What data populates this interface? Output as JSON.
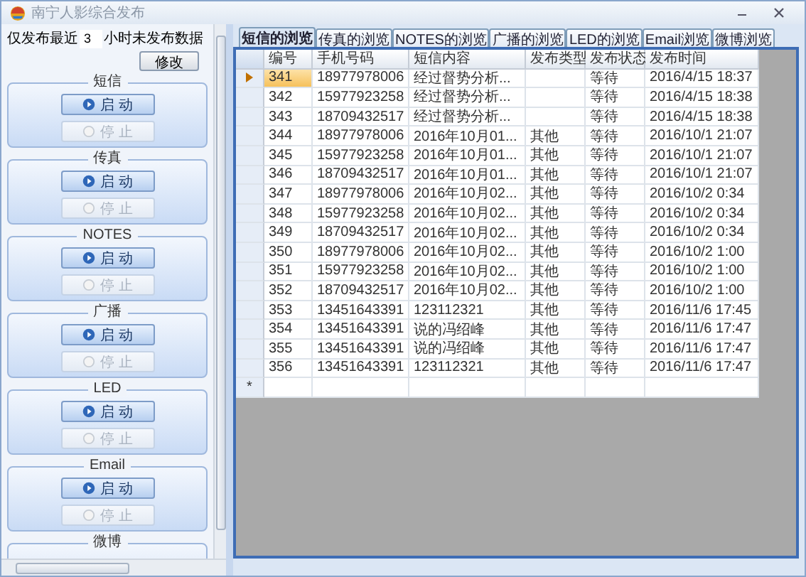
{
  "window": {
    "title": "南宁人影综合发布"
  },
  "publish_filter": {
    "prefix": "仅发布最近",
    "hours": "3",
    "suffix": "小时未发布数据",
    "button": "修改"
  },
  "channels": [
    {
      "name": "短信",
      "start": {
        "label": "启 动",
        "disabled": false
      },
      "stop": {
        "label": "停 止",
        "disabled": true
      }
    },
    {
      "name": "传真",
      "start": {
        "label": "启 动",
        "disabled": false
      },
      "stop": {
        "label": "停 止",
        "disabled": true
      }
    },
    {
      "name": "NOTES",
      "start": {
        "label": "启 动",
        "disabled": false
      },
      "stop": {
        "label": "停 止",
        "disabled": true
      }
    },
    {
      "name": "广播",
      "start": {
        "label": "启 动",
        "disabled": false
      },
      "stop": {
        "label": "停 止",
        "disabled": true
      }
    },
    {
      "name": "LED",
      "start": {
        "label": "启 动",
        "disabled": false
      },
      "stop": {
        "label": "停 止",
        "disabled": true
      }
    },
    {
      "name": "Email",
      "start": {
        "label": "启 动",
        "disabled": false
      },
      "stop": {
        "label": "停 止",
        "disabled": true
      }
    },
    {
      "name": "微博"
    }
  ],
  "tabs": [
    {
      "label": "短信的浏览",
      "selected": true
    },
    {
      "label": "传真的浏览",
      "selected": false
    },
    {
      "label": "NOTES的浏览",
      "selected": false
    },
    {
      "label": "广播的浏览",
      "selected": false
    },
    {
      "label": "LED的浏览",
      "selected": false
    },
    {
      "label": "Email浏览",
      "selected": false
    },
    {
      "label": "微博浏览",
      "selected": false
    }
  ],
  "table": {
    "columns": [
      "编号",
      "手机号码",
      "短信内容",
      "发布类型",
      "发布状态",
      "发布时间"
    ],
    "rows": [
      {
        "selected": true,
        "cells": [
          "341",
          "18977978006",
          "经过督势分析...",
          "",
          "等待",
          "2016/4/15 18:37"
        ]
      },
      {
        "selected": false,
        "cells": [
          "342",
          "15977923258",
          "经过督势分析...",
          "",
          "等待",
          "2016/4/15 18:38"
        ]
      },
      {
        "selected": false,
        "cells": [
          "343",
          "18709432517",
          "经过督势分析...",
          "",
          "等待",
          "2016/4/15 18:38"
        ]
      },
      {
        "selected": false,
        "cells": [
          "344",
          "18977978006",
          "2016年10月01...",
          "其他",
          "等待",
          "2016/10/1 21:07"
        ]
      },
      {
        "selected": false,
        "cells": [
          "345",
          "15977923258",
          "2016年10月01...",
          "其他",
          "等待",
          "2016/10/1 21:07"
        ]
      },
      {
        "selected": false,
        "cells": [
          "346",
          "18709432517",
          "2016年10月01...",
          "其他",
          "等待",
          "2016/10/1 21:07"
        ]
      },
      {
        "selected": false,
        "cells": [
          "347",
          "18977978006",
          "2016年10月02...",
          "其他",
          "等待",
          "2016/10/2 0:34"
        ]
      },
      {
        "selected": false,
        "cells": [
          "348",
          "15977923258",
          "2016年10月02...",
          "其他",
          "等待",
          "2016/10/2 0:34"
        ]
      },
      {
        "selected": false,
        "cells": [
          "349",
          "18709432517",
          "2016年10月02...",
          "其他",
          "等待",
          "2016/10/2 0:34"
        ]
      },
      {
        "selected": false,
        "cells": [
          "350",
          "18977978006",
          "2016年10月02...",
          "其他",
          "等待",
          "2016/10/2 1:00"
        ]
      },
      {
        "selected": false,
        "cells": [
          "351",
          "15977923258",
          "2016年10月02...",
          "其他",
          "等待",
          "2016/10/2 1:00"
        ]
      },
      {
        "selected": false,
        "cells": [
          "352",
          "18709432517",
          "2016年10月02...",
          "其他",
          "等待",
          "2016/10/2 1:00"
        ]
      },
      {
        "selected": false,
        "cells": [
          "353",
          "13451643391",
          "123112321",
          "其他",
          "等待",
          "2016/11/6 17:45"
        ]
      },
      {
        "selected": false,
        "cells": [
          "354",
          "13451643391",
          "说的冯绍峰",
          "其他",
          "等待",
          "2016/11/6 17:47"
        ]
      },
      {
        "selected": false,
        "cells": [
          "355",
          "13451643391",
          "说的冯绍峰",
          "其他",
          "等待",
          "2016/11/6 17:47"
        ]
      },
      {
        "selected": false,
        "cells": [
          "356",
          "13451643391",
          "123112321",
          "其他",
          "等待",
          "2016/11/6 17:47"
        ]
      }
    ],
    "new_row_marker": "*"
  }
}
